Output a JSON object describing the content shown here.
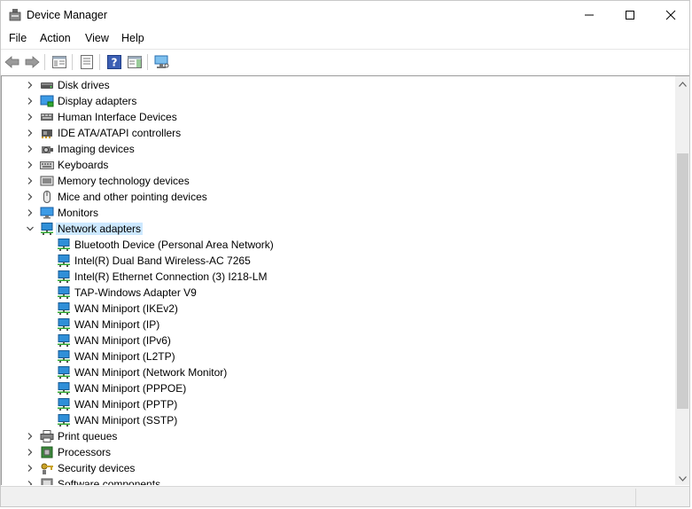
{
  "window": {
    "title": "Device Manager"
  },
  "menu": [
    "File",
    "Action",
    "View",
    "Help"
  ],
  "toolbar": [
    "back",
    "forward",
    "show-hide-console-tree",
    "properties",
    "help",
    "action-pane",
    "scan-for-hardware-changes"
  ],
  "colors": {
    "selection": "#cce8ff",
    "network_icon": "#2f8fd8",
    "scrollbar_thumb": "#cdcdcd"
  },
  "tree": [
    {
      "label": "Disk drives",
      "expanded": false,
      "icon": "disk-drive-icon"
    },
    {
      "label": "Display adapters",
      "expanded": false,
      "icon": "display-adapter-icon"
    },
    {
      "label": "Human Interface Devices",
      "expanded": false,
      "icon": "hid-icon"
    },
    {
      "label": "IDE ATA/ATAPI controllers",
      "expanded": false,
      "icon": "ide-controller-icon"
    },
    {
      "label": "Imaging devices",
      "expanded": false,
      "icon": "camera-icon"
    },
    {
      "label": "Keyboards",
      "expanded": false,
      "icon": "keyboard-icon"
    },
    {
      "label": "Memory technology devices",
      "expanded": false,
      "icon": "memory-icon"
    },
    {
      "label": "Mice and other pointing devices",
      "expanded": false,
      "icon": "mouse-icon"
    },
    {
      "label": "Monitors",
      "expanded": false,
      "icon": "monitor-icon"
    },
    {
      "label": "Network adapters",
      "expanded": true,
      "selected": true,
      "icon": "network-adapter-icon",
      "children": [
        "Bluetooth Device (Personal Area Network)",
        "Intel(R) Dual Band Wireless-AC 7265",
        "Intel(R) Ethernet Connection (3) I218-LM",
        "TAP-Windows Adapter V9",
        "WAN Miniport (IKEv2)",
        "WAN Miniport (IP)",
        "WAN Miniport (IPv6)",
        "WAN Miniport (L2TP)",
        "WAN Miniport (Network Monitor)",
        "WAN Miniport (PPPOE)",
        "WAN Miniport (PPTP)",
        "WAN Miniport (SSTP)"
      ]
    },
    {
      "label": "Print queues",
      "expanded": false,
      "icon": "printer-icon"
    },
    {
      "label": "Processors",
      "expanded": false,
      "icon": "processor-icon"
    },
    {
      "label": "Security devices",
      "expanded": false,
      "icon": "security-key-icon"
    },
    {
      "label": "Software components",
      "expanded": false,
      "icon": "software-component-icon"
    }
  ]
}
